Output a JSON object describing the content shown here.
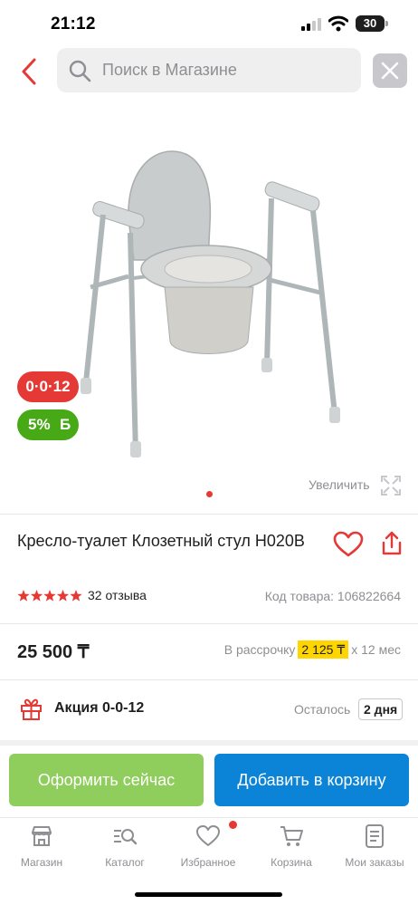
{
  "status_bar": {
    "time": "21:12",
    "battery": "30"
  },
  "search": {
    "placeholder": "Поиск в Магазине",
    "value": ""
  },
  "gallery": {
    "badge_installment": "0·0·12",
    "badge_bonus_percent": "5%",
    "badge_bonus_letter": "Б",
    "zoom_label": "Увеличить"
  },
  "product": {
    "title": "Кресло-туалет Клозетный стул H020B",
    "rating_stars": 5,
    "reviews": "32 отзыва",
    "code": "Код товара: 106822664",
    "price": "25 500 ₸",
    "installment_prefix": "В рассрочку",
    "installment_amount": "2 125 ₸",
    "installment_suffix": "x 12 мес"
  },
  "promo": {
    "label": "Акция 0-0-12",
    "remaining_prefix": "Осталось",
    "remaining_value": "2 дня"
  },
  "actions": {
    "checkout": "Оформить сейчас",
    "add_to_cart": "Добавить в корзину"
  },
  "tabs": [
    {
      "label": "Магазин",
      "icon": "store-icon"
    },
    {
      "label": "Каталог",
      "icon": "catalog-search-icon"
    },
    {
      "label": "Избранное",
      "icon": "heart-icon"
    },
    {
      "label": "Корзина",
      "icon": "cart-icon"
    },
    {
      "label": "Мои заказы",
      "icon": "orders-icon"
    }
  ],
  "colors": {
    "accent_red": "#e53935",
    "bonus_green": "#48a916",
    "checkout_green": "#8fcd5c",
    "cart_blue": "#0b84d8",
    "installment_yellow": "#ffd500",
    "star_red": "#e53935"
  }
}
